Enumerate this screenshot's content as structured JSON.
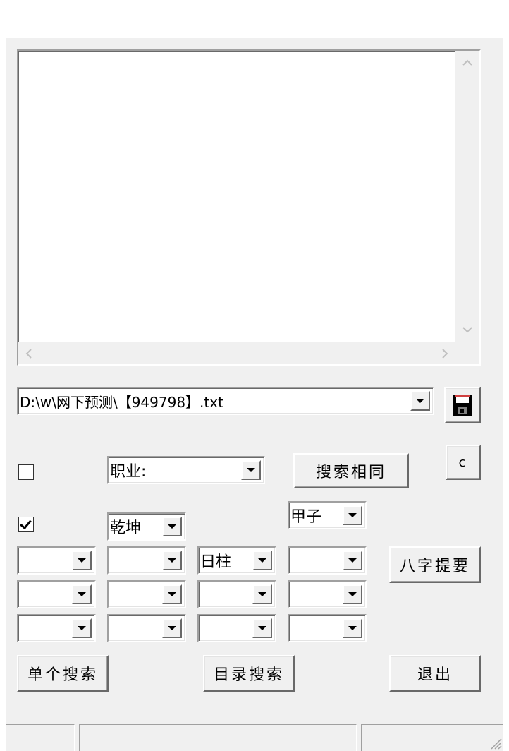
{
  "file_path": {
    "value": "D:\\w\\网下预测\\【949798】.txt"
  },
  "buttons": {
    "search_same": "搜索相同",
    "c": "c",
    "bazi_summary": "八字提要",
    "single_search": "单个搜索",
    "dir_search": "目录搜索",
    "exit": "退出"
  },
  "filters": {
    "field_select": "职业:",
    "gender_select": "乾坤",
    "jiazi_select": "甲子",
    "checkbox1_checked": false,
    "checkbox2_checked": true
  },
  "pillar_grid": {
    "rows": [
      [
        "",
        "",
        "日柱",
        ""
      ],
      [
        "",
        "",
        "",
        ""
      ],
      [
        "",
        "",
        "",
        ""
      ]
    ]
  },
  "icons": {
    "save": "floppy-disk-icon"
  }
}
